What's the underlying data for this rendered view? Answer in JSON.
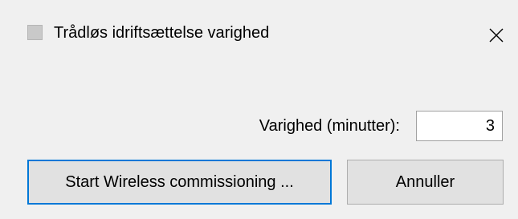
{
  "window": {
    "title": "Trådløs idriftsættelse varighed",
    "icon": "app-icon",
    "close_icon": "close-icon"
  },
  "form": {
    "duration_label": "Varighed (minutter):",
    "duration_value": "3"
  },
  "buttons": {
    "start_label": "Start Wireless commissioning ...",
    "cancel_label": "Annuller"
  },
  "colors": {
    "background": "#f0f0f0",
    "button_face": "#e1e1e1",
    "focus_border": "#0078d7"
  }
}
